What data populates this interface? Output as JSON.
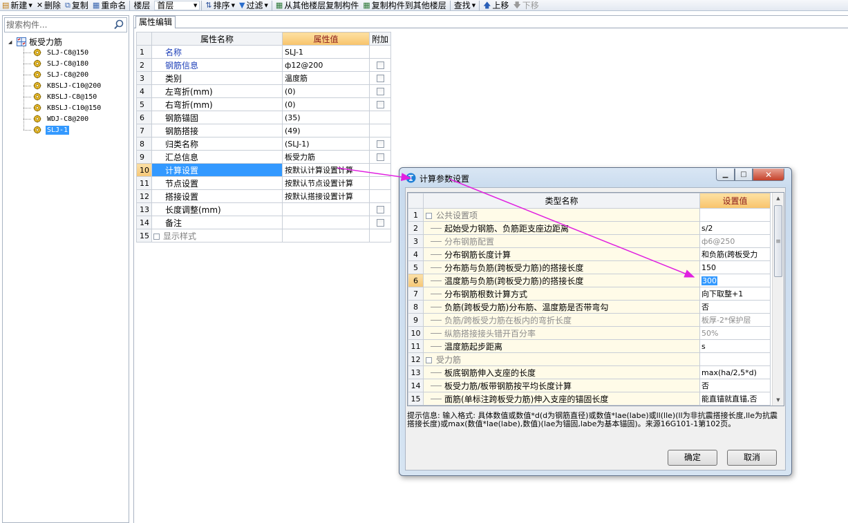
{
  "toolbar": {
    "new": "新建",
    "delete": "删除",
    "copy": "复制",
    "rename": "重命名",
    "floor_label": "楼层",
    "floor_value": "首层",
    "sort": "排序",
    "filter": "过滤",
    "copy_from_floor": "从其他楼层复制构件",
    "copy_to_floor": "复制构件到其他楼层",
    "find": "查找",
    "move_up": "上移",
    "move_down": "下移"
  },
  "search": {
    "placeholder": "搜索构件..."
  },
  "tree": {
    "root": "板受力筋",
    "items": [
      "SLJ-C8@150",
      "SLJ-C8@180",
      "SLJ-C8@200",
      "KBSLJ-C10@200",
      "KBSLJ-C8@150",
      "KBSLJ-C10@150",
      "WDJ-C8@200",
      "SLJ-1"
    ],
    "selected": "SLJ-1"
  },
  "tab": {
    "label": "属性编辑"
  },
  "prop_grid": {
    "headers": [
      "属性名称",
      "属性值",
      "附加"
    ],
    "rows": [
      {
        "num": "1",
        "name": "名称",
        "value": "SLJ-1",
        "check": false,
        "blue": true
      },
      {
        "num": "2",
        "name": "钢筋信息",
        "value": "ф12@200",
        "check": true,
        "blue": true
      },
      {
        "num": "3",
        "name": "类别",
        "value": "温度筋",
        "check": true
      },
      {
        "num": "4",
        "name": "左弯折(mm)",
        "value": "(0)",
        "check": true
      },
      {
        "num": "5",
        "name": "右弯折(mm)",
        "value": "(0)",
        "check": true
      },
      {
        "num": "6",
        "name": "钢筋锚固",
        "value": "(35)",
        "check": false
      },
      {
        "num": "7",
        "name": "钢筋搭接",
        "value": "(49)",
        "check": false
      },
      {
        "num": "8",
        "name": "归类名称",
        "value": "(SLJ-1)",
        "check": true
      },
      {
        "num": "9",
        "name": "汇总信息",
        "value": "板受力筋",
        "check": true
      },
      {
        "num": "10",
        "name": "计算设置",
        "value": "按默认计算设置计算",
        "check": false,
        "selected": true
      },
      {
        "num": "11",
        "name": "节点设置",
        "value": "按默认节点设置计算",
        "check": false
      },
      {
        "num": "12",
        "name": "搭接设置",
        "value": "按默认搭接设置计算",
        "check": false
      },
      {
        "num": "13",
        "name": "长度调整(mm)",
        "value": "",
        "check": true
      },
      {
        "num": "14",
        "name": "备注",
        "value": "",
        "check": true
      },
      {
        "num": "15",
        "name": "显示样式",
        "value": "",
        "check": false,
        "group": true
      }
    ]
  },
  "dialog": {
    "title": "计算参数设置",
    "headers": [
      "类型名称",
      "设置值"
    ],
    "rows": [
      {
        "num": "1",
        "name": "公共设置项",
        "value": "",
        "group": true
      },
      {
        "num": "2",
        "name": "起始受力钢筋、负筋距支座边距离",
        "value": "s/2"
      },
      {
        "num": "3",
        "name": "分布钢筋配置",
        "value": "ф6@250",
        "muted": true
      },
      {
        "num": "4",
        "name": "分布钢筋长度计算",
        "value": "和负筋(跨板受力"
      },
      {
        "num": "5",
        "name": "分布筋与负筋(跨板受力筋)的搭接长度",
        "value": "150"
      },
      {
        "num": "6",
        "name": "温度筋与负筋(跨板受力筋)的搭接长度",
        "value": "300",
        "active": true
      },
      {
        "num": "7",
        "name": "分布钢筋根数计算方式",
        "value": "向下取整+1"
      },
      {
        "num": "8",
        "name": "负筋(跨板受力筋)分布筋、温度筋是否带弯勾",
        "value": "否"
      },
      {
        "num": "9",
        "name": "负筋/跨板受力筋在板内的弯折长度",
        "value": "板厚-2*保护层",
        "muted": true
      },
      {
        "num": "10",
        "name": "纵筋搭接接头错开百分率",
        "value": "50%",
        "muted": true
      },
      {
        "num": "11",
        "name": "温度筋起步距离",
        "value": "s"
      },
      {
        "num": "12",
        "name": "受力筋",
        "value": "",
        "group": true
      },
      {
        "num": "13",
        "name": "板底钢筋伸入支座的长度",
        "value": "max(ha/2,5*d)"
      },
      {
        "num": "14",
        "name": "板受力筋/板带钢筋按平均长度计算",
        "value": "否"
      },
      {
        "num": "15",
        "name": "面筋(单标注跨板受力筋)伸入支座的锚固长度",
        "value": "能直锚就直锚,否"
      }
    ],
    "hint": "提示信息: 输入格式: 具体数值或数值*d(d为钢筋直径)或数值*lae(labe)或ll(lle)(ll为非抗震搭接长度,lle为抗震搭接长度)或max(数值*lae(labe),数值)(lae为锚固,labe为基本锚固)。来源16G101-1第102页。",
    "ok": "确定",
    "cancel": "取消"
  },
  "colors": {
    "accent": "#3399ff",
    "arrow": "#e020e0",
    "header_value_bg": "#f8c36b",
    "link_blue": "#1d3fb8"
  }
}
